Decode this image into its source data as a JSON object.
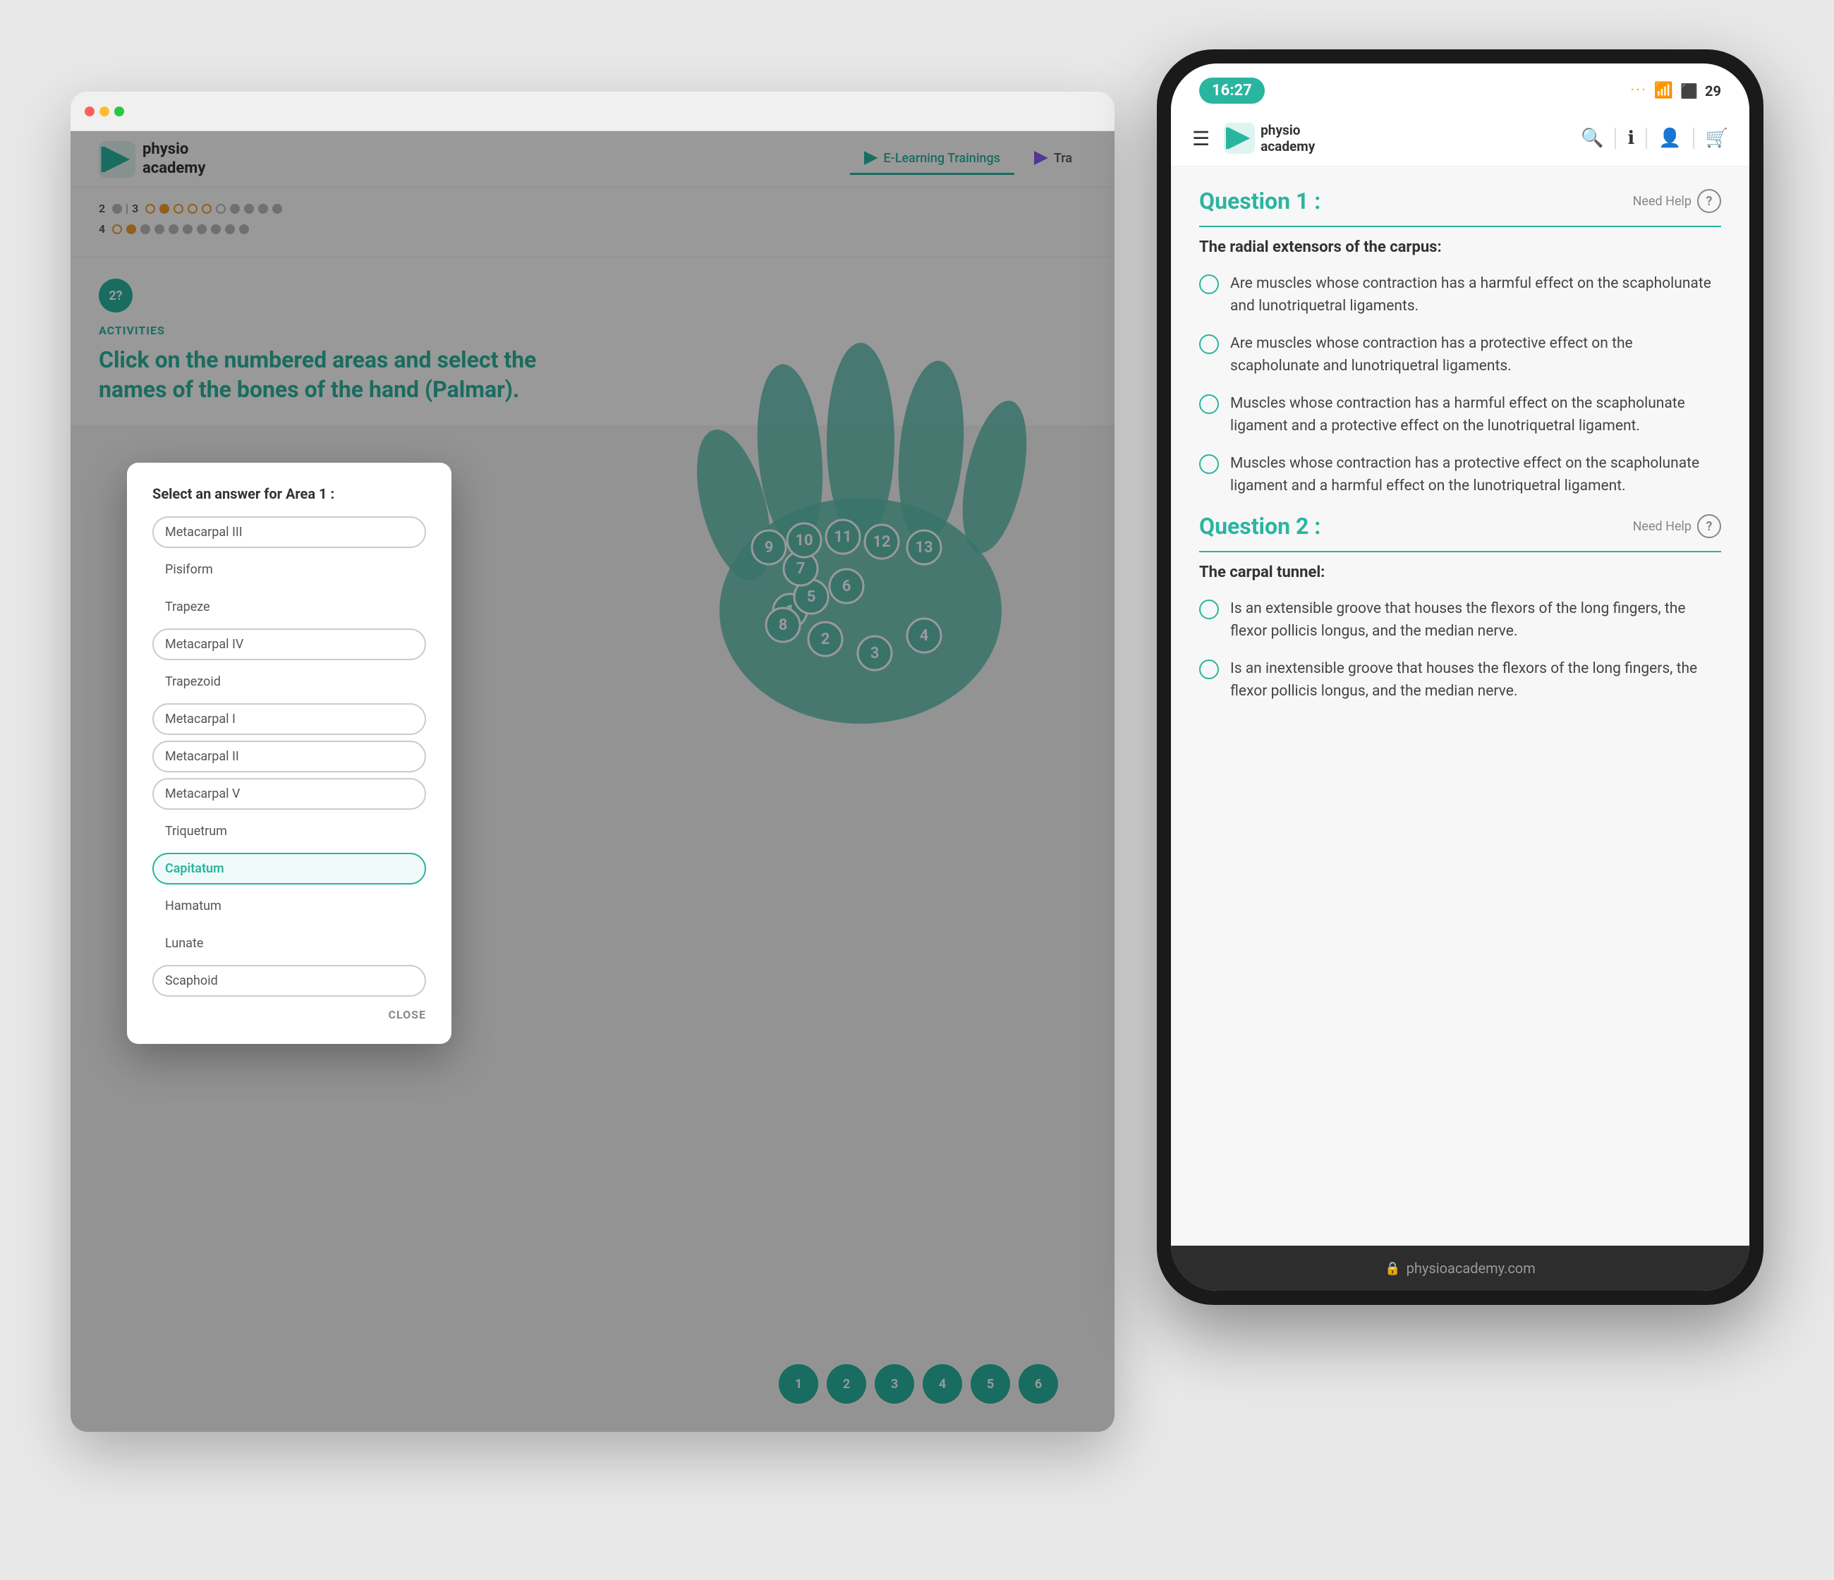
{
  "desktop": {
    "nav": {
      "logo_line1": "physio",
      "logo_line2": "academy",
      "tabs": [
        {
          "label": "E-Learning Trainings",
          "active": true
        },
        {
          "label": "Tra",
          "active": false
        }
      ]
    },
    "progress": {
      "rows": [
        {
          "label": "2",
          "dots": [
            "filled",
            "divider",
            "3",
            "empty-orange",
            "connector",
            "empty-orange",
            "empty-orange",
            "gray",
            "gray",
            "gray",
            "gray",
            "gray",
            "gray"
          ]
        },
        {
          "label": "4",
          "dots": [
            "filled-orange",
            "gray",
            "gray",
            "gray",
            "gray",
            "gray",
            "gray",
            "gray",
            "gray"
          ]
        }
      ]
    },
    "activity": {
      "badge_text": "2?",
      "label": "ACTIVITIES",
      "title": "Click on the numbered areas and select the names of the bones of the hand (Palmar)."
    },
    "modal": {
      "title": "Select an answer for Area 1 :",
      "items": [
        {
          "label": "Metacarpal III",
          "type": "box",
          "selected": false
        },
        {
          "label": "Pisiform",
          "type": "plain"
        },
        {
          "label": "Trapeze",
          "type": "plain"
        },
        {
          "label": "Metacarpal IV",
          "type": "box",
          "selected": false
        },
        {
          "label": "Trapezoid",
          "type": "plain"
        },
        {
          "label": "Metacarpal I",
          "type": "box",
          "selected": false
        },
        {
          "label": "Metacarpal II",
          "type": "box",
          "selected": false
        },
        {
          "label": "Metacarpal V",
          "type": "box",
          "selected": false
        },
        {
          "label": "Triquetrum",
          "type": "plain"
        },
        {
          "label": "Capitatum",
          "type": "box",
          "selected": true
        },
        {
          "label": "Hamatum",
          "type": "plain"
        },
        {
          "label": "Lunate",
          "type": "plain"
        },
        {
          "label": "Scaphoid",
          "type": "box",
          "selected": false
        }
      ],
      "close_label": "CLOSE"
    },
    "pagination": {
      "items": [
        "1",
        "2",
        "3",
        "4",
        "5",
        "6"
      ]
    }
  },
  "mobile": {
    "status_bar": {
      "time": "16:27",
      "battery": "29"
    },
    "nav": {
      "logo_line1": "physio",
      "logo_line2": "academy"
    },
    "questions": [
      {
        "title": "Question 1 :",
        "need_help": "Need Help",
        "subtitle": "The radial extensors of the carpus:",
        "options": [
          "Are muscles whose contraction has a harmful effect on the scapholunate and lunotriquetral ligaments.",
          "Are muscles whose contraction has a protective effect on the scapholunate and lunotriquetral ligaments.",
          "Muscles whose contraction has a harmful effect on the scapholunate ligament and a protective effect on the lunotriquetral ligament.",
          "Muscles whose contraction has a protective effect on the scapholunate ligament and a harmful effect on the lunotriquetral ligament."
        ]
      },
      {
        "title": "Question 2 :",
        "need_help": "Need Help",
        "subtitle": "The carpal tunnel:",
        "options": [
          "Is an extensible groove that houses the flexors of the long fingers, the flexor pollicis longus, and the median nerve.",
          "Is an inextensible groove that houses the flexors of the long fingers, the flexor pollicis longus, and the median nerve."
        ]
      }
    ],
    "footer": {
      "url": "physioacademy.com"
    }
  }
}
